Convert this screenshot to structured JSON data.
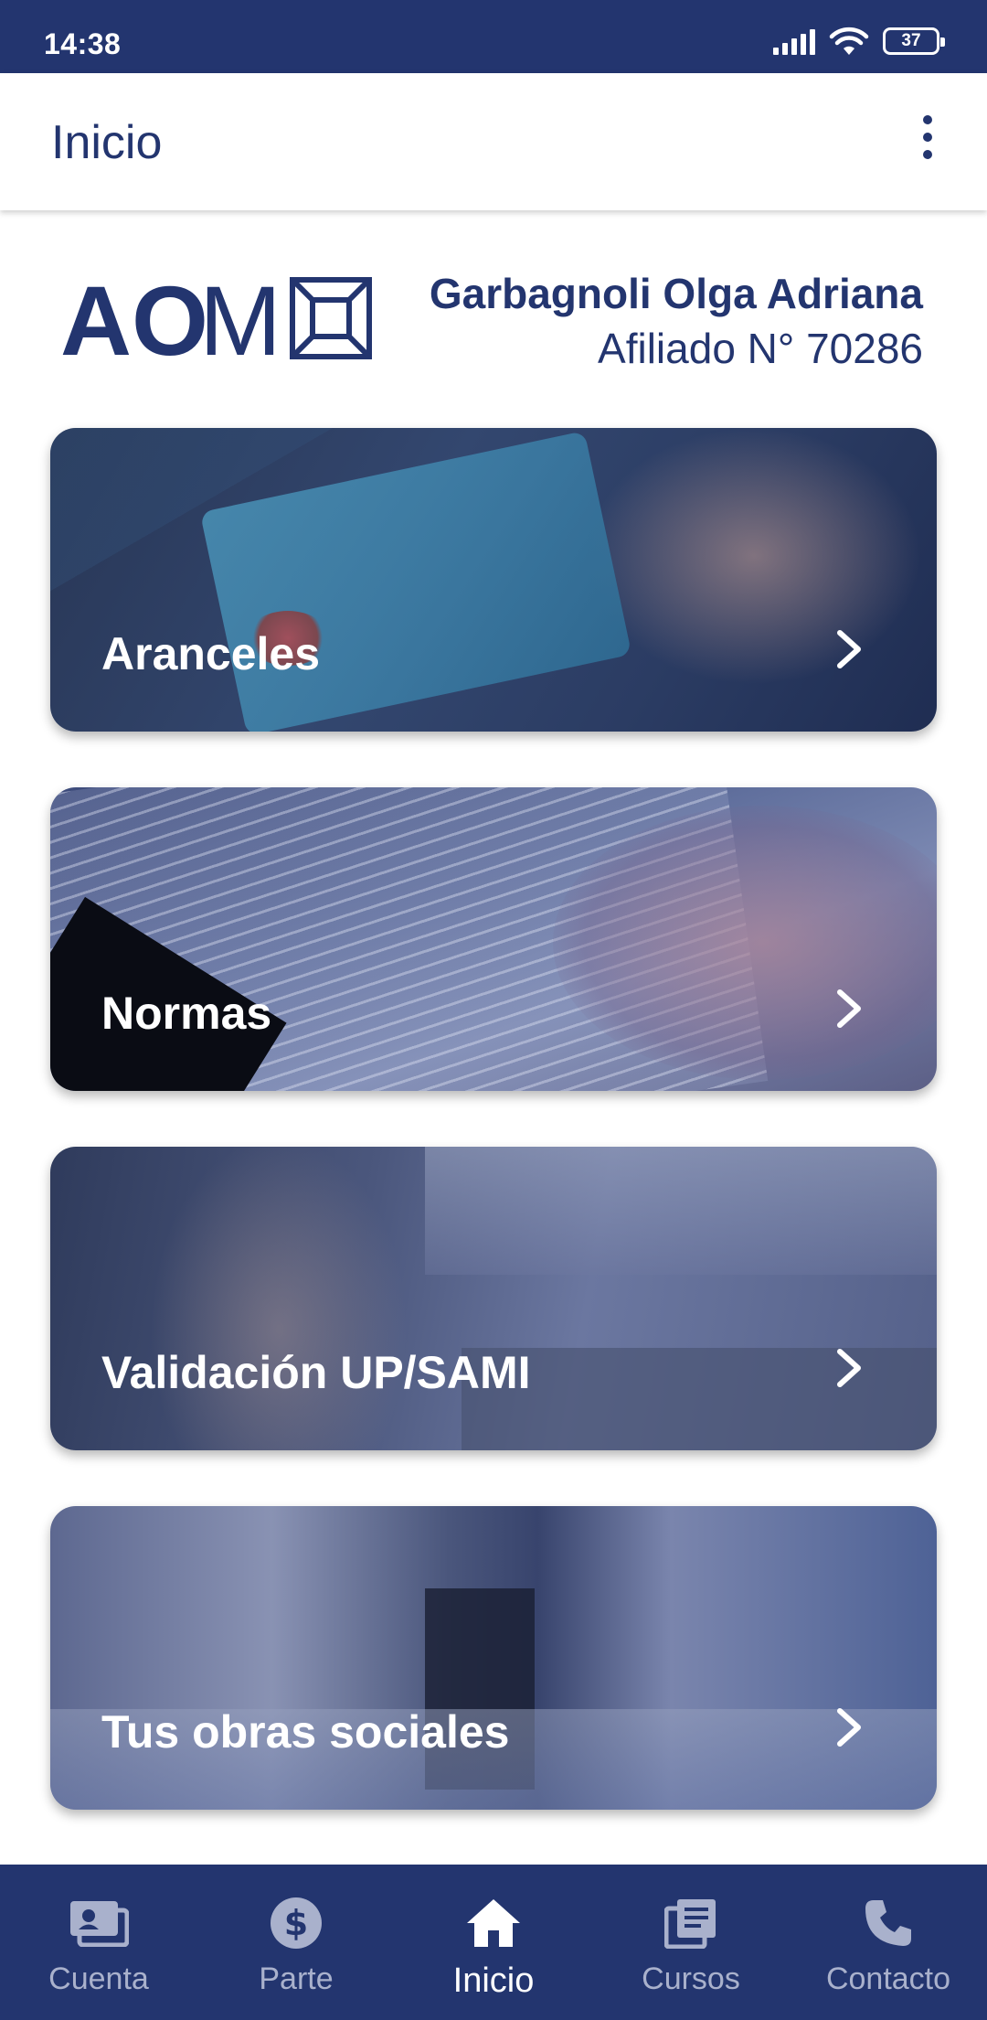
{
  "status_bar": {
    "time": "14:38",
    "battery": "37"
  },
  "app_bar": {
    "title": "Inicio"
  },
  "header": {
    "logo_text": "AOM",
    "member_name": "Garbagnoli Olga Adriana",
    "member_number": "Afiliado N° 70286"
  },
  "cards": [
    {
      "label": "Aranceles"
    },
    {
      "label": "Normas"
    },
    {
      "label": "Validación UP/SAMI"
    },
    {
      "label": "Tus obras sociales"
    }
  ],
  "bottom_nav": {
    "items": [
      {
        "label": "Cuenta",
        "icon": "account-card-icon"
      },
      {
        "label": "Parte",
        "icon": "dollar-icon"
      },
      {
        "label": "Inicio",
        "icon": "home-icon"
      },
      {
        "label": "Cursos",
        "icon": "courses-icon"
      },
      {
        "label": "Contacto",
        "icon": "phone-icon"
      }
    ],
    "active": "Inicio"
  },
  "colors": {
    "primary": "#23356f",
    "nav_inactive": "#a9b1cc",
    "nav_active": "#ffffff"
  }
}
